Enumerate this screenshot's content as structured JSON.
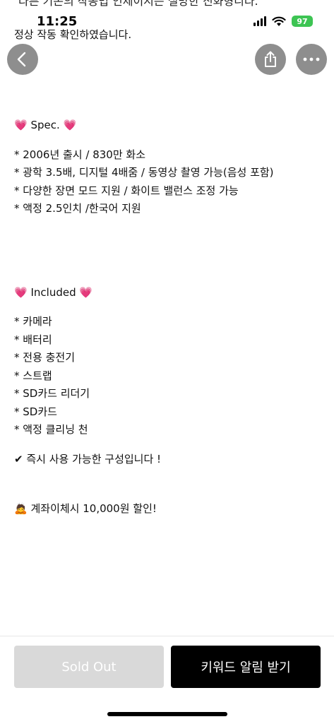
{
  "status_bar": {
    "clipped_line": "다른 기존의 작동법 인제이지는 실망한 진화형니다.",
    "time": "11:25",
    "battery": "97"
  },
  "top_line": "정상 작동 확인하였습니다.",
  "icons": {
    "back": "chevron-left-icon",
    "share": "share-icon",
    "more": "ellipsis-icon",
    "heart": "sparkling-heart-icon",
    "check": "check-mark-icon",
    "money": "money-bag-person-icon"
  },
  "spec": {
    "heading": "Spec.",
    "items": [
      "* 2006년 출시 / 830만 화소",
      "* 광학 3.5배, 디지털 4배줌 / 동영상 촬영 가능(음성 포함)",
      "* 다양한 장면 모드 지원 / 화이트 밸런스 조정 가능",
      "* 액정 2.5인치 /한국어 지원"
    ]
  },
  "included": {
    "heading": "Included",
    "items": [
      "* 카메라",
      "* 배터리",
      "* 전용 충전기",
      "* 스트랩",
      "* SD카드 리더기",
      "* SD카드",
      "* 액정 클리닝 천"
    ]
  },
  "ready_text": "즉시 사용 가능한 구성입니다 !",
  "discount_text": "계좌이체시 10,000원 할인!",
  "bottom": {
    "sold_out_label": "Sold Out",
    "keyword_label": "키워드 알림 받기"
  }
}
